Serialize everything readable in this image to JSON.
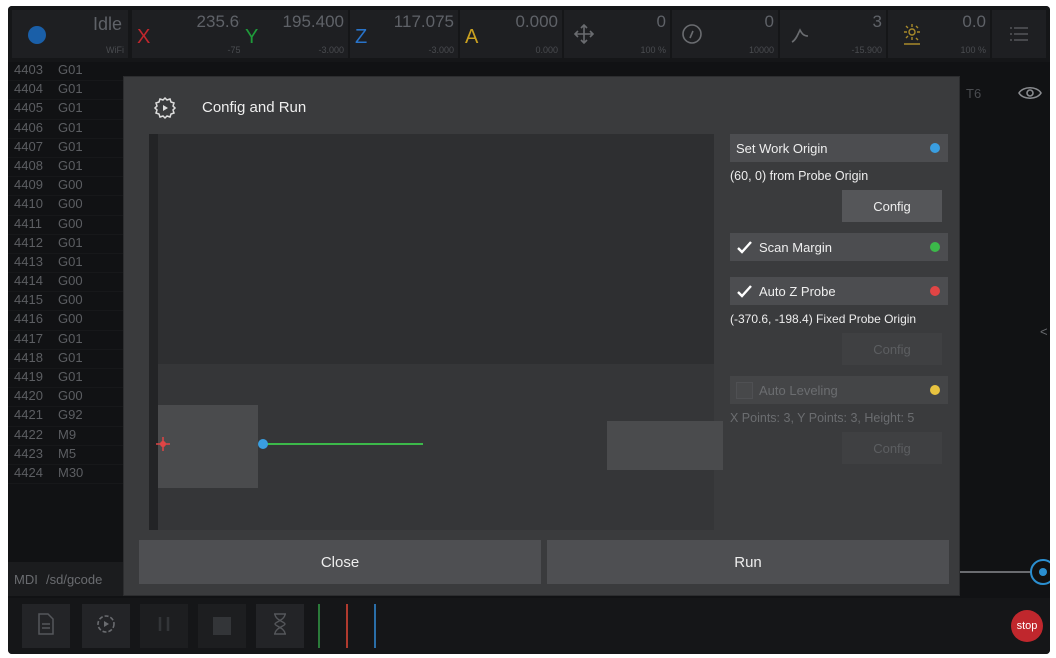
{
  "status": {
    "state": "Idle",
    "connection": "WiFi",
    "x": {
      "label": "X",
      "value": "235.600",
      "sub": "-75.000"
    },
    "y": {
      "label": "Y",
      "value": "195.400",
      "sub": "-3.000"
    },
    "z": {
      "label": "Z",
      "value": "117.075",
      "sub": "-3.000"
    },
    "a": {
      "label": "A",
      "value": "0.000",
      "sub": "0.000"
    },
    "feed": {
      "value": "0",
      "sub": "100 %"
    },
    "spindle": {
      "value": "0",
      "sub": "10000"
    },
    "probe": {
      "value": "3",
      "sub": "-15.900"
    },
    "laser": {
      "value": "0.0",
      "sub": "100 %"
    }
  },
  "listing": [
    {
      "num": "4403",
      "code": "G01"
    },
    {
      "num": "4404",
      "code": "G01"
    },
    {
      "num": "4405",
      "code": "G01"
    },
    {
      "num": "4406",
      "code": "G01"
    },
    {
      "num": "4407",
      "code": "G01"
    },
    {
      "num": "4408",
      "code": "G01"
    },
    {
      "num": "4409",
      "code": "G00"
    },
    {
      "num": "4410",
      "code": "G00"
    },
    {
      "num": "4411",
      "code": "G00"
    },
    {
      "num": "4412",
      "code": "G01"
    },
    {
      "num": "4413",
      "code": "G01"
    },
    {
      "num": "4414",
      "code": "G00"
    },
    {
      "num": "4415",
      "code": "G00"
    },
    {
      "num": "4416",
      "code": "G00"
    },
    {
      "num": "4417",
      "code": "G01"
    },
    {
      "num": "4418",
      "code": "G01"
    },
    {
      "num": "4419",
      "code": "G01"
    },
    {
      "num": "4420",
      "code": "G00"
    },
    {
      "num": "4421",
      "code": "G92"
    },
    {
      "num": "4422",
      "code": "M9"
    },
    {
      "num": "4423",
      "code": "M5"
    },
    {
      "num": "4424",
      "code": "M30"
    }
  ],
  "tool": "T6",
  "mdi": {
    "label": "MDI",
    "path": "/sd/gcode"
  },
  "side_toggle": "<",
  "dialog": {
    "title": "Config and Run",
    "work_origin": {
      "label": "Set Work Origin",
      "color": "#3a9ee0",
      "info": "(60, 0) from Probe Origin",
      "config": "Config"
    },
    "scan_margin": {
      "label": "Scan Margin",
      "color": "#3cb94a",
      "checked": true
    },
    "auto_z_probe": {
      "label": "Auto Z Probe",
      "color": "#e04545",
      "checked": true,
      "info": "(-370.6, -198.4) Fixed Probe Origin",
      "config": "Config"
    },
    "auto_leveling": {
      "label": "Auto Leveling",
      "color": "#e8c340",
      "checked": false,
      "info": "X Points: 3, Y Points: 3, Height: 5",
      "config": "Config"
    },
    "close": "Close",
    "run": "Run"
  },
  "toolbar": {
    "stop": "stop"
  }
}
